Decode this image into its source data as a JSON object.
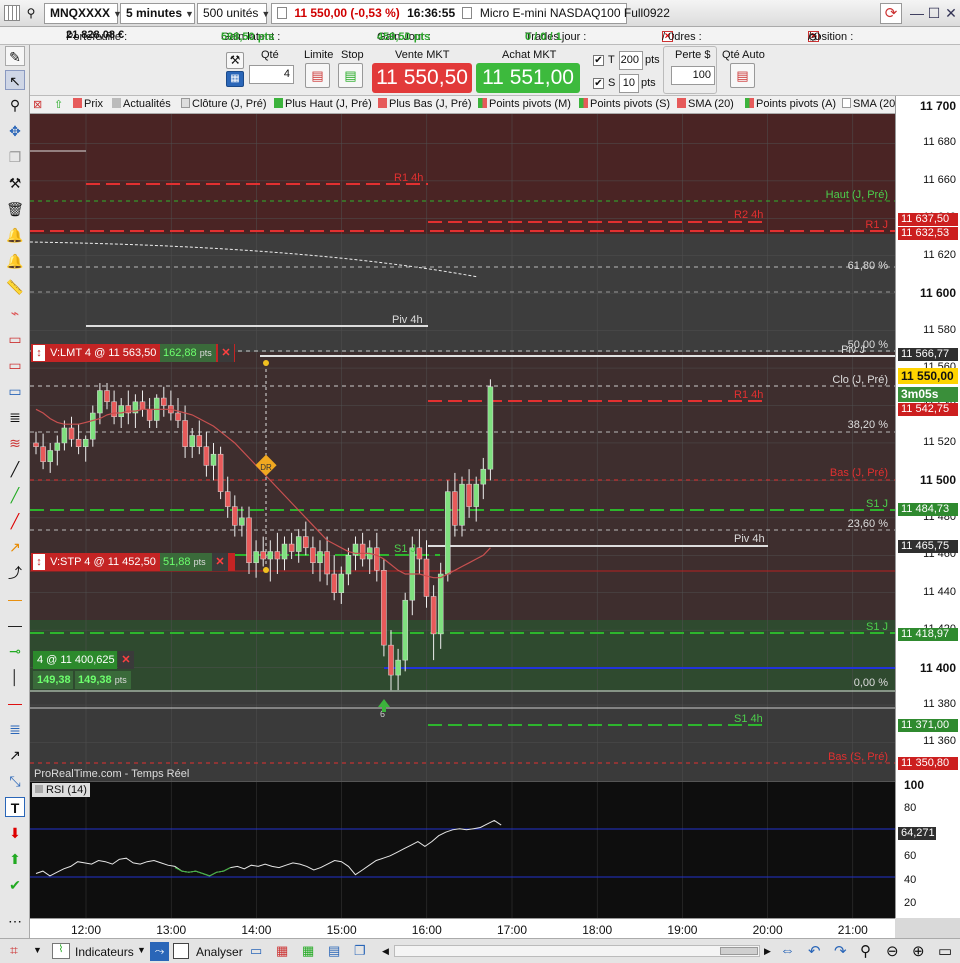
{
  "titlebar": {
    "symbol": "MNQXXXX",
    "interval": "5 minutes",
    "units": "500 unités",
    "quote": "11 550,00 (-0,53 %)",
    "time": "16:36:55",
    "instrument": "Micro E-mini NASDAQ100 Full0922"
  },
  "account": {
    "portfolio_label": "Portefeuille :",
    "portfolio": "21 828,08 €",
    "latent_label": "Gain latent :",
    "latent": "598,50 pts",
    "day_label": "Gain Jour :",
    "day": "459,50 pts",
    "trades_label": "Trades jour :",
    "trades": "0 / 0 / 1",
    "orders_label": "Ordres :",
    "orders_a": "2",
    "orders_b": "/ 0",
    "position_label": "Position :",
    "position_a": "4",
    "position_b": "/ 0"
  },
  "orderbar": {
    "qty_label": "Qté",
    "qty": "4",
    "limit_label": "Limite",
    "stop_label": "Stop",
    "sell_label": "Vente MKT",
    "sell": "11 550,50",
    "buy_label": "Achat MKT",
    "buy": "11 551,00",
    "t_label": "T",
    "t_value": "200",
    "s_label": "S",
    "s_value": "10",
    "pts": "pts",
    "loss_label": "Perte $",
    "loss": "100",
    "qty_auto": "Qté Auto"
  },
  "indicators": [
    "Prix",
    "Actualités",
    "Clôture (J, Pré)",
    "Plus Haut (J, Pré)",
    "Plus Bas (J, Pré)",
    "Points pivots (M)",
    "Points pivots (S)",
    "SMA (20)",
    "Points pivots (A)",
    "SMA (20)"
  ],
  "orders": {
    "lmt": {
      "label": "V:LMT  4 @ 11 563,50",
      "pts": "162,88",
      "unit": "pts"
    },
    "stp": {
      "label": "V:STP  4 @ 11 452,50",
      "pts": "51,88",
      "unit": "pts"
    },
    "pos": {
      "label": "4 @ 11 400,625",
      "pts1": "149,38",
      "pts2": "149,38",
      "unit": "pts"
    }
  },
  "chart_lines": {
    "r1_4h": "R1 4h",
    "r2_4h": "R2 4h",
    "r1_j": "R1 J",
    "haut_j": "Haut (J, Pré)",
    "fib618": "61,80 %",
    "piv4h": "Piv 4h",
    "fib50": "50,00 %",
    "piv_j": "Piv J",
    "clo_j": "Clo (J, Pré)",
    "r1_4h_b": "R1 4h",
    "fib382": "38,20 %",
    "bas_j": "Bas (J, Pré)",
    "s1_j": "S1 J",
    "fib236": "23,60 %",
    "piv4h_b": "Piv 4h",
    "s1_w": "S1 J",
    "fib0": "0,00 %",
    "s1_4h": "S1 4h",
    "bas_s": "Bas (S, Pré)",
    "dr": "DR",
    "fill_count": "6",
    "source": "ProRealTime.com - Temps Réel",
    "s1_s": "S1 J"
  },
  "price_axis": {
    "labels": [
      "11 700",
      "11 680",
      "11 660",
      "11 640",
      "11 620",
      "11 600",
      "11 580",
      "11 560",
      "11 540",
      "11 520",
      "11 500",
      "11 480",
      "11 460",
      "11 440",
      "11 420",
      "11 400",
      "11 380",
      "11 360"
    ],
    "tags": [
      {
        "text": "11 637,50",
        "color": "#cc1f1f"
      },
      {
        "text": "11 632,53",
        "color": "#cc1f1f"
      },
      {
        "text": "11 566,77",
        "color": "#2f2f2f"
      },
      {
        "text": "11 550,00",
        "color": "#ffd400"
      },
      {
        "text": "3m05s",
        "color": "#3a8f3a"
      },
      {
        "text": "11 542,75",
        "color": "#cc1f1f"
      },
      {
        "text": "11 484,73",
        "color": "#2f8a2f"
      },
      {
        "text": "11 465,75",
        "color": "#2f2f2f"
      },
      {
        "text": "11 418,97",
        "color": "#2f8a2f"
      },
      {
        "text": "11 371,00",
        "color": "#2f8a2f"
      },
      {
        "text": "11 350,80",
        "color": "#cc1f1f"
      }
    ]
  },
  "rsi": {
    "label": "RSI (14)",
    "labels": [
      "100",
      "80",
      "60",
      "40",
      "20"
    ],
    "value": "64,271",
    "series": [
      25,
      27,
      23,
      26,
      29,
      31,
      35,
      34,
      33,
      36,
      35,
      33,
      37,
      38,
      34,
      33,
      35,
      36,
      34,
      32,
      31,
      27,
      26,
      27,
      25,
      23,
      26,
      27,
      30,
      31,
      29,
      32,
      31,
      33,
      31,
      30,
      32,
      34,
      33,
      31,
      28,
      30,
      33,
      36,
      35,
      31,
      24,
      28,
      32,
      36,
      38,
      40,
      43,
      46,
      49,
      52,
      48,
      52,
      57,
      60,
      62,
      63,
      62,
      63,
      64,
      67,
      70,
      66
    ]
  },
  "time_axis": [
    "12:00",
    "13:00",
    "14:00",
    "15:00",
    "16:00",
    "17:00",
    "18:00",
    "19:00",
    "20:00",
    "21:00"
  ],
  "candles": [
    [
      11520,
      11526,
      11514,
      11518
    ],
    [
      11518,
      11525,
      11506,
      11510
    ],
    [
      11510,
      11520,
      11504,
      11516
    ],
    [
      11516,
      11524,
      11508,
      11520
    ],
    [
      11520,
      11532,
      11516,
      11528
    ],
    [
      11528,
      11534,
      11518,
      11522
    ],
    [
      11522,
      11530,
      11514,
      11518
    ],
    [
      11518,
      11524,
      11510,
      11522
    ],
    [
      11522,
      11540,
      11518,
      11536
    ],
    [
      11536,
      11552,
      11530,
      11548
    ],
    [
      11548,
      11552,
      11538,
      11542
    ],
    [
      11542,
      11548,
      11530,
      11534
    ],
    [
      11534,
      11544,
      11528,
      11540
    ],
    [
      11540,
      11548,
      11530,
      11536
    ],
    [
      11536,
      11546,
      11528,
      11542
    ],
    [
      11542,
      11548,
      11534,
      11538
    ],
    [
      11538,
      11544,
      11528,
      11532
    ],
    [
      11532,
      11546,
      11528,
      11544
    ],
    [
      11544,
      11550,
      11534,
      11540
    ],
    [
      11540,
      11548,
      11532,
      11536
    ],
    [
      11536,
      11544,
      11528,
      11532
    ],
    [
      11532,
      11540,
      11512,
      11518
    ],
    [
      11518,
      11528,
      11512,
      11524
    ],
    [
      11524,
      11532,
      11514,
      11518
    ],
    [
      11518,
      11526,
      11502,
      11508
    ],
    [
      11508,
      11520,
      11500,
      11514
    ],
    [
      11514,
      11518,
      11490,
      11494
    ],
    [
      11494,
      11502,
      11480,
      11486
    ],
    [
      11486,
      11492,
      11470,
      11476
    ],
    [
      11476,
      11486,
      11470,
      11480
    ],
    [
      11480,
      11486,
      11450,
      11456
    ],
    [
      11456,
      11468,
      11448,
      11462
    ],
    [
      11462,
      11470,
      11454,
      11458
    ],
    [
      11458,
      11468,
      11446,
      11462
    ],
    [
      11462,
      11472,
      11450,
      11458
    ],
    [
      11458,
      11470,
      11452,
      11466
    ],
    [
      11466,
      11472,
      11458,
      11462
    ],
    [
      11462,
      11474,
      11456,
      11470
    ],
    [
      11470,
      11478,
      11460,
      11464
    ],
    [
      11464,
      11470,
      11450,
      11456
    ],
    [
      11456,
      11468,
      11446,
      11462
    ],
    [
      11462,
      11470,
      11444,
      11450
    ],
    [
      11450,
      11460,
      11436,
      11440
    ],
    [
      11440,
      11454,
      11434,
      11450
    ],
    [
      11450,
      11464,
      11444,
      11460
    ],
    [
      11460,
      11470,
      11452,
      11466
    ],
    [
      11466,
      11472,
      11454,
      11458
    ],
    [
      11458,
      11468,
      11450,
      11464
    ],
    [
      11464,
      11472,
      11446,
      11452
    ],
    [
      11452,
      11458,
      11406,
      11412
    ],
    [
      11412,
      11420,
      11388,
      11396
    ],
    [
      11396,
      11410,
      11388,
      11404
    ],
    [
      11404,
      11440,
      11398,
      11436
    ],
    [
      11436,
      11470,
      11428,
      11464
    ],
    [
      11464,
      11474,
      11450,
      11458
    ],
    [
      11458,
      11468,
      11432,
      11438
    ],
    [
      11438,
      11444,
      11404,
      11418
    ],
    [
      11418,
      11456,
      11410,
      11450
    ],
    [
      11450,
      11500,
      11446,
      11494
    ],
    [
      11494,
      11504,
      11470,
      11476
    ],
    [
      11476,
      11502,
      11470,
      11498
    ],
    [
      11498,
      11506,
      11480,
      11486
    ],
    [
      11486,
      11502,
      11478,
      11498
    ],
    [
      11498,
      11512,
      11490,
      11506
    ],
    [
      11506,
      11554,
      11500,
      11550
    ]
  ],
  "sma": [
    11538,
    11536,
    11533,
    11531,
    11530,
    11530,
    11530,
    11531,
    11532,
    11533,
    11535,
    11536,
    11536,
    11537,
    11537,
    11538,
    11538,
    11538,
    11538,
    11538,
    11537,
    11536,
    11535,
    11533,
    11531,
    11529,
    11526,
    11523,
    11520,
    11516,
    11512,
    11508,
    11504,
    11500,
    11496,
    11492,
    11488,
    11484,
    11480,
    11476,
    11472,
    11468,
    11466,
    11464,
    11462,
    11461,
    11461,
    11461,
    11460,
    11458,
    11455,
    11452,
    11450,
    11450,
    11450,
    11449,
    11448,
    11448,
    11450,
    11452,
    11454,
    11456,
    11458,
    11460,
    11464
  ]
}
